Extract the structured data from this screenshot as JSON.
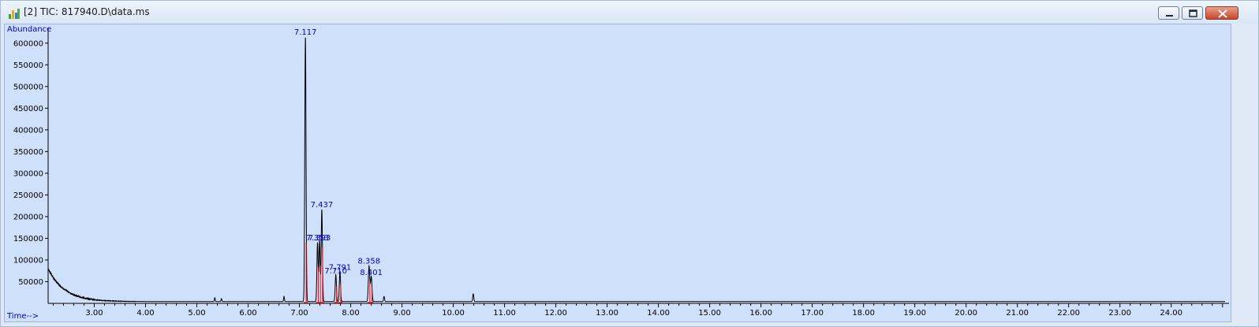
{
  "window": {
    "title": "[2] TIC: 817940.D\\data.ms"
  },
  "icons": {
    "app": "chromatogram-app-icon",
    "minimize": "minimize-icon",
    "maximize": "maximize-icon",
    "close": "close-icon"
  },
  "chart_data": {
    "type": "line",
    "ylabel": "Abundance",
    "xlabel": "Time-->",
    "xlim": [
      2.1,
      25.05
    ],
    "ylim": [
      0,
      625000
    ],
    "grid": false,
    "x_ticks": [
      3.0,
      4.0,
      5.0,
      6.0,
      7.0,
      8.0,
      9.0,
      10.0,
      11.0,
      12.0,
      13.0,
      14.0,
      15.0,
      16.0,
      17.0,
      18.0,
      19.0,
      20.0,
      21.0,
      22.0,
      23.0,
      24.0
    ],
    "x_tick_labels": [
      "3.00",
      "4.00",
      "5.00",
      "6.00",
      "7.00",
      "8.00",
      "9.00",
      "10.00",
      "11.00",
      "12.00",
      "13.00",
      "14.00",
      "15.00",
      "16.00",
      "17.00",
      "18.00",
      "19.00",
      "20.00",
      "21.00",
      "22.00",
      "23.00",
      "24.00"
    ],
    "y_ticks": [
      50000,
      100000,
      150000,
      200000,
      250000,
      300000,
      350000,
      400000,
      450000,
      500000,
      550000,
      600000
    ],
    "y_tick_labels": [
      "50000",
      "100000",
      "150000",
      "200000",
      "250000",
      "300000",
      "350000",
      "400000",
      "450000",
      "500000",
      "550000",
      "600000"
    ],
    "colors": {
      "trace": "#000000",
      "integration": "#ff0000",
      "label": "#0000cc",
      "axis": "#000000"
    },
    "baseline": {
      "start_x": 2.1,
      "start_y": 80000,
      "decay_constant": 0.32,
      "floor": 4000
    },
    "peaks": [
      {
        "x": 5.35,
        "height": 9000,
        "width": 0.008
      },
      {
        "x": 5.48,
        "height": 7000,
        "width": 0.008
      },
      {
        "x": 6.7,
        "height": 12000,
        "width": 0.008
      },
      {
        "x": 7.117,
        "height": 610000,
        "width": 0.012
      },
      {
        "x": 7.353,
        "height": 135000,
        "width": 0.012
      },
      {
        "x": 7.393,
        "height": 140000,
        "width": 0.012
      },
      {
        "x": 7.437,
        "height": 212000,
        "width": 0.012
      },
      {
        "x": 7.71,
        "height": 62000,
        "width": 0.012
      },
      {
        "x": 7.791,
        "height": 70000,
        "width": 0.012
      },
      {
        "x": 8.358,
        "height": 82000,
        "width": 0.014
      },
      {
        "x": 8.401,
        "height": 58000,
        "width": 0.014
      },
      {
        "x": 8.65,
        "height": 12000,
        "width": 0.01
      },
      {
        "x": 10.39,
        "height": 18000,
        "width": 0.01
      }
    ],
    "peak_labels": [
      {
        "text": "7.117",
        "x": 7.117,
        "y": 620000
      },
      {
        "text": "7.437",
        "x": 7.437,
        "y": 222000
      },
      {
        "text": "7.393",
        "x": 7.393,
        "y": 145000
      },
      {
        "text": "7.353",
        "x": 7.353,
        "y": 145000
      },
      {
        "text": "7.791",
        "x": 7.791,
        "y": 77000
      },
      {
        "text": "7.710",
        "x": 7.71,
        "y": 69000
      },
      {
        "text": "8.358",
        "x": 8.358,
        "y": 92000
      },
      {
        "text": "8.401",
        "x": 8.401,
        "y": 65000
      }
    ]
  }
}
